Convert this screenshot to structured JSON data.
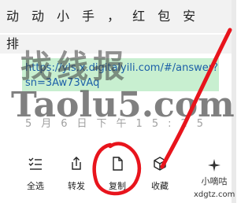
{
  "message": {
    "line1_chars": [
      "动",
      "动",
      "小",
      "手",
      "，",
      "红",
      "包",
      "安"
    ],
    "line2_char": "排",
    "link_line1": "https://yls.x.digitalyili.com/#/answer?",
    "link_line2": "sn=3Aw73vAq",
    "timestamp": "5月6日下午15:25"
  },
  "toolbar": {
    "select_all": "全选",
    "forward": "转发",
    "copy": "复制",
    "favorite": "收藏"
  },
  "icons": {
    "select_all": "checklist-icon",
    "forward": "share-icon",
    "copy": "document-icon",
    "favorite": "cube-icon"
  },
  "watermarks": {
    "chinese": "找线报",
    "english": "Taolu5.com",
    "corner_line1": "小嘀咕",
    "corner_line2": "xdgtz.com"
  },
  "colors": {
    "annotation": "#e8141c",
    "link": "#1c5fa8",
    "highlight": "#c8efd0"
  }
}
